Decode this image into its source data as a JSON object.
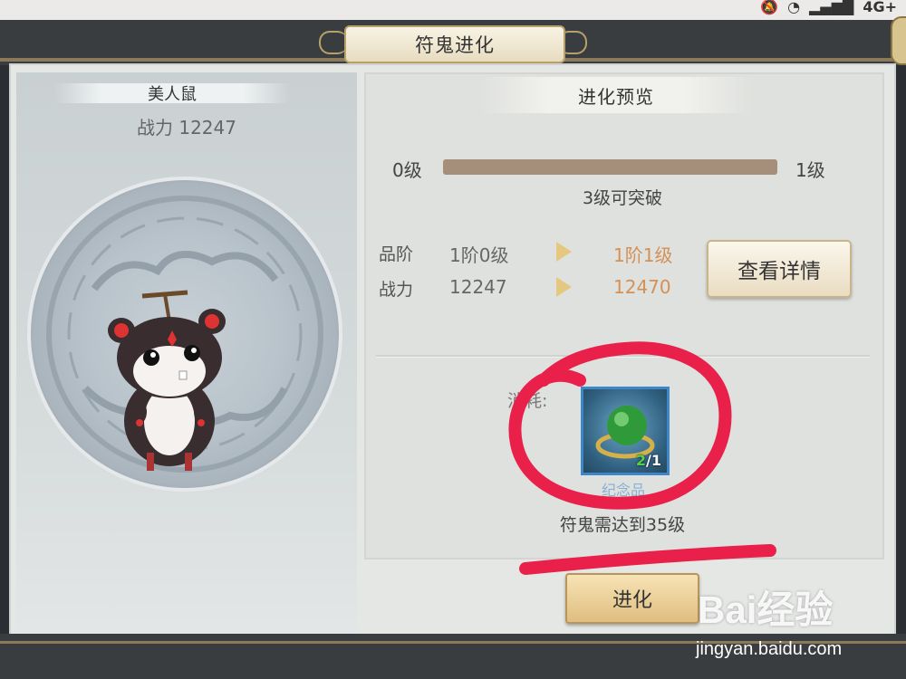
{
  "status_bar": {
    "network": "4G+"
  },
  "window": {
    "title": "符鬼进化"
  },
  "pet": {
    "name": "美人鼠",
    "power_text": "战力 12247"
  },
  "preview": {
    "title": "进化预览",
    "level_from": "0级",
    "level_to": "1级",
    "level_progress": 1.0,
    "break_note": "3级可突破",
    "rows": [
      {
        "label": "品阶",
        "current": "1阶0级",
        "next": "1阶1级"
      },
      {
        "label": "战力",
        "current": "12247",
        "next": "12470"
      }
    ],
    "details_button": "查看详情"
  },
  "consume": {
    "label": "消耗:",
    "item": {
      "have": "2",
      "sep": "/",
      "need": "1",
      "name": "纪念品"
    },
    "requirement": "符鬼需达到35级"
  },
  "evolve_button": "进化",
  "watermark": {
    "logo": "Bai经验",
    "url": "jingyan.baidu.com"
  },
  "colors": {
    "accent_gold": "#b8a06a",
    "next_value": "#d49055",
    "annotation": "#e8204a"
  }
}
